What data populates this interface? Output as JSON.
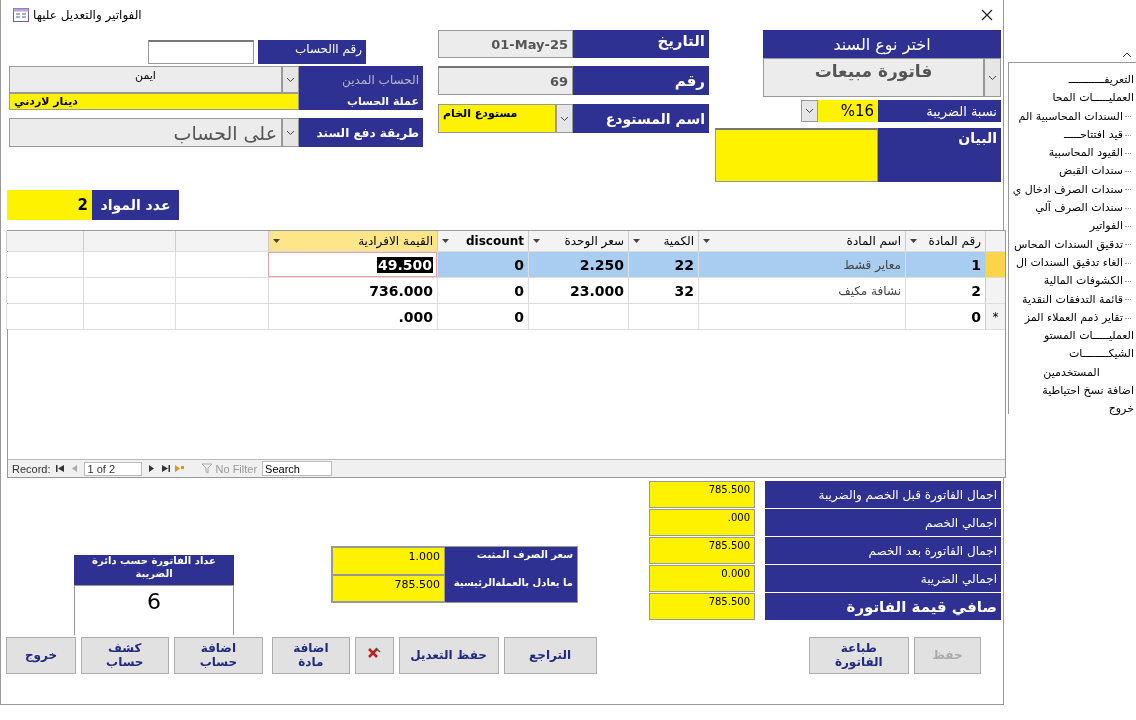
{
  "window": {
    "title": "الفواتير  والتعديل عليها"
  },
  "header": {
    "account_number": {
      "label": "رقم االحساب"
    },
    "debit_account": {
      "label": "الحساب المدين",
      "value": "ايمن"
    },
    "currency": {
      "label": "عملة الحساب",
      "value": "دينار لاردني"
    },
    "payment_method": {
      "label": "طريقة دفع السند",
      "value": "على الحساب"
    },
    "items_count": {
      "label": "عدد المواد",
      "value": "2"
    },
    "date": {
      "label": "التاريخ",
      "value": "01-May-25"
    },
    "number": {
      "label": "رقم",
      "value": "69"
    },
    "warehouse": {
      "label": "اسم المستودع",
      "value": "مستودع الخام"
    },
    "voucher_type": {
      "label": "اختر نوع السند",
      "value": "فاتورة مبيعات"
    },
    "tax_rate": {
      "label": "نسبة الضريبة",
      "value": "%16"
    },
    "description": {
      "label": "البيان"
    }
  },
  "table": {
    "columns": [
      {
        "label": "رقم المادة",
        "selected": false
      },
      {
        "label": "اسم المادة",
        "selected": false
      },
      {
        "label": "الكمية",
        "selected": false
      },
      {
        "label": "سعر الوحدة",
        "selected": false
      },
      {
        "label": "discount",
        "selected": false
      },
      {
        "label": "القيمة الافرادية",
        "selected": true
      }
    ],
    "rows": [
      {
        "selected": true,
        "cells": [
          {
            "text": "1",
            "focused": false
          },
          {
            "text": "معاير قشط",
            "focused": false
          },
          {
            "text": "22",
            "focused": false
          },
          {
            "text": "2.250",
            "focused": false
          },
          {
            "text": "0",
            "focused": false
          },
          {
            "text": "49.500",
            "focused": true
          }
        ]
      },
      {
        "selected": false,
        "cells": [
          {
            "text": "2",
            "focused": false
          },
          {
            "text": "نشافة مكيف",
            "focused": false
          },
          {
            "text": "32",
            "focused": false
          },
          {
            "text": "23.000",
            "focused": false
          },
          {
            "text": "0",
            "focused": false
          },
          {
            "text": "736.000",
            "focused": false
          }
        ]
      },
      {
        "selected": false,
        "marker": "*",
        "cells": [
          {
            "text": "0",
            "focused": false
          },
          {
            "text": null,
            "focused": false
          },
          {
            "text": null,
            "focused": false
          },
          {
            "text": null,
            "focused": false
          },
          {
            "text": "0",
            "focused": false
          },
          {
            "text": ".000",
            "focused": false
          }
        ]
      }
    ]
  },
  "record_nav": {
    "label": "Record:",
    "position": "1 of 2",
    "filter": "No Filter",
    "search": {
      "placeholder": "Search"
    }
  },
  "totals": [
    {
      "kind": "line",
      "label": "اجمال الفاتورة قبل الخصم والضريبة",
      "value": "785.500"
    },
    {
      "kind": "line",
      "label": "اجمالي الخصم",
      "value": ".000"
    },
    {
      "kind": "line",
      "label": "اجمال الفاتورة بعد الخصم",
      "value": "785.500"
    },
    {
      "kind": "line",
      "label": "اجمالي الضريبة",
      "value": "0.000"
    },
    {
      "kind": "net",
      "label": "صافي قيمة الفاتورة",
      "value": "785.500"
    }
  ],
  "exchange": [
    {
      "label": "سعر الصرف المثبت",
      "value": "1.000"
    },
    {
      "label": "ما يعادل بالعملةالرئيسية",
      "value": "785.500"
    }
  ],
  "counter": {
    "label": "عداد الفاتورة حسب دائرة الضريبة",
    "value": "6"
  },
  "buttons": [
    {
      "kind": "text",
      "label": "حفظ",
      "disabled": true
    },
    {
      "kind": "text",
      "label": "طباعة الفاتورة",
      "disabled": false
    },
    {
      "kind": "text",
      "label": "التراجع",
      "disabled": false
    },
    {
      "kind": "text",
      "label": "حفظ التعديل",
      "disabled": false
    },
    {
      "kind": "icon",
      "disabled": false
    },
    {
      "kind": "text",
      "label": "اضافة مادة",
      "disabled": false
    },
    {
      "kind": "text",
      "label": "اضافة حساب",
      "disabled": false
    },
    {
      "kind": "text",
      "label": "كشف حساب",
      "disabled": false
    },
    {
      "kind": "text",
      "label": "خروج",
      "disabled": false
    }
  ],
  "navigation": {
    "items": [
      {
        "label": "التعريفـــــــــــ"
      },
      {
        "label": "العمليـــــات المحا",
        "children": [
          {
            "label": "السندات المحاسبية الم"
          },
          {
            "label": "قيد افتتاحـــــ"
          },
          {
            "label": "القيود المحاسبية"
          },
          {
            "label": "سندات القبض"
          },
          {
            "label": "سندات الصرف ادخال ي"
          },
          {
            "label": "سندات الصرف آلي"
          },
          {
            "label": "الفواتير"
          },
          {
            "label": "تدقيق السندات المحاس"
          },
          {
            "label": "الغاء تدقيق السندات ال"
          },
          {
            "label": "الكشوفات المالية"
          },
          {
            "label": "قائمة التدفقات النقدية"
          },
          {
            "label": "تقاير ذمم العملاء المز"
          }
        ]
      },
      {
        "label": "العمليـــــات المستو"
      },
      {
        "label": "الشيكــــــــات"
      },
      {
        "label": "المستخدمين"
      },
      {
        "label": "اضافة نسخ احتياطية"
      },
      {
        "label": "خروج"
      }
    ]
  }
}
